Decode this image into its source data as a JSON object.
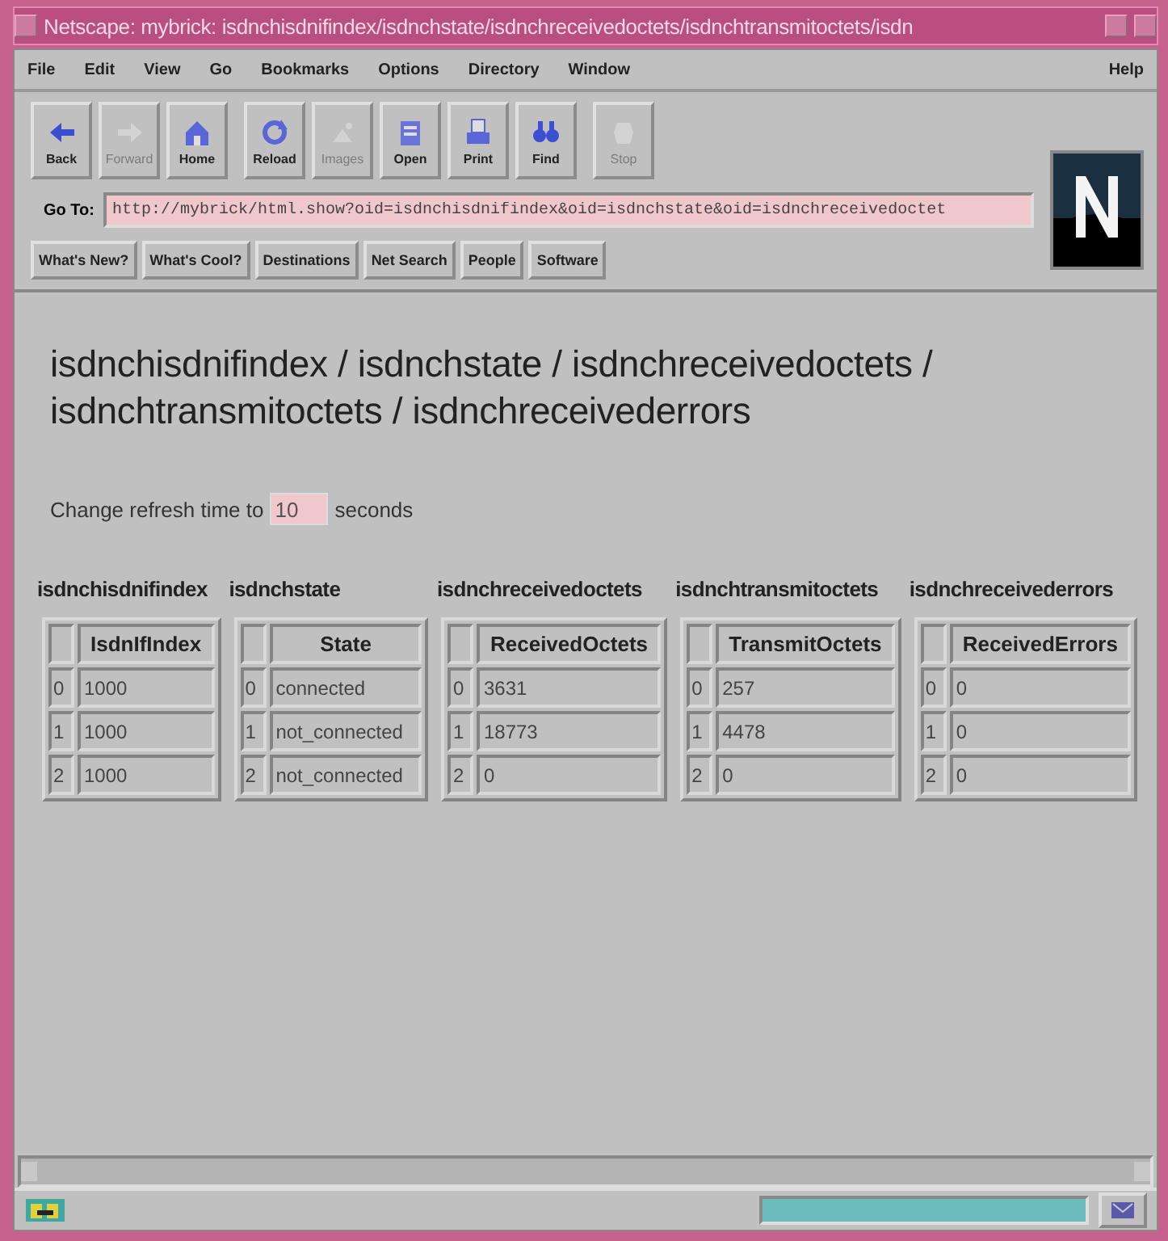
{
  "window": {
    "title": "Netscape: mybrick: isdnchisdnifindex/isdnchstate/isdnchreceivedoctets/isdnchtransmitoctets/isdn"
  },
  "menu": {
    "items": [
      "File",
      "Edit",
      "View",
      "Go",
      "Bookmarks",
      "Options",
      "Directory",
      "Window"
    ],
    "help": "Help"
  },
  "toolbar": [
    {
      "label": "Back",
      "kind": "back",
      "disabled": false
    },
    {
      "label": "Forward",
      "kind": "forward",
      "disabled": true
    },
    {
      "label": "Home",
      "kind": "home",
      "disabled": false
    },
    {
      "label": "Reload",
      "kind": "reload",
      "disabled": false
    },
    {
      "label": "Images",
      "kind": "images",
      "disabled": true
    },
    {
      "label": "Open",
      "kind": "open",
      "disabled": false
    },
    {
      "label": "Print",
      "kind": "print",
      "disabled": false
    },
    {
      "label": "Find",
      "kind": "find",
      "disabled": false
    },
    {
      "label": "Stop",
      "kind": "stop",
      "disabled": true
    }
  ],
  "location": {
    "label": "Go To:",
    "value": "http://mybrick/html.show?oid=isdnchisdnifindex&oid=isdnchstate&oid=isdnchreceivedoctet"
  },
  "directory_buttons": [
    "What's New?",
    "What's Cool?",
    "Destinations",
    "Net Search",
    "People",
    "Software"
  ],
  "page": {
    "heading": "isdnchisdnifindex / isdnchstate / isdnchreceivedoctets / isdnchtransmitoctets / isdnchreceivederrors",
    "refresh": {
      "before": "Change refresh time to",
      "value": "10",
      "after": "seconds"
    },
    "tables": [
      {
        "title": "isdnchisdnifindex",
        "column": "IsdnIfIndex",
        "rows": [
          [
            "0",
            "1000"
          ],
          [
            "1",
            "1000"
          ],
          [
            "2",
            "1000"
          ]
        ]
      },
      {
        "title": "isdnchstate",
        "column": "State",
        "rows": [
          [
            "0",
            "connected"
          ],
          [
            "1",
            "not_connected"
          ],
          [
            "2",
            "not_connected"
          ]
        ]
      },
      {
        "title": "isdnchreceivedoctets",
        "column": "ReceivedOctets",
        "rows": [
          [
            "0",
            "3631"
          ],
          [
            "1",
            "18773"
          ],
          [
            "2",
            "0"
          ]
        ]
      },
      {
        "title": "isdnchtransmitoctets",
        "column": "TransmitOctets",
        "rows": [
          [
            "0",
            "257"
          ],
          [
            "1",
            "4478"
          ],
          [
            "2",
            "0"
          ]
        ]
      },
      {
        "title": "isdnchreceivederrors",
        "column": "ReceivedErrors",
        "rows": [
          [
            "0",
            "0"
          ],
          [
            "1",
            "0"
          ],
          [
            "2",
            "0"
          ]
        ]
      }
    ]
  },
  "status_bar": {
    "progress": {
      "level": 1
    }
  }
}
